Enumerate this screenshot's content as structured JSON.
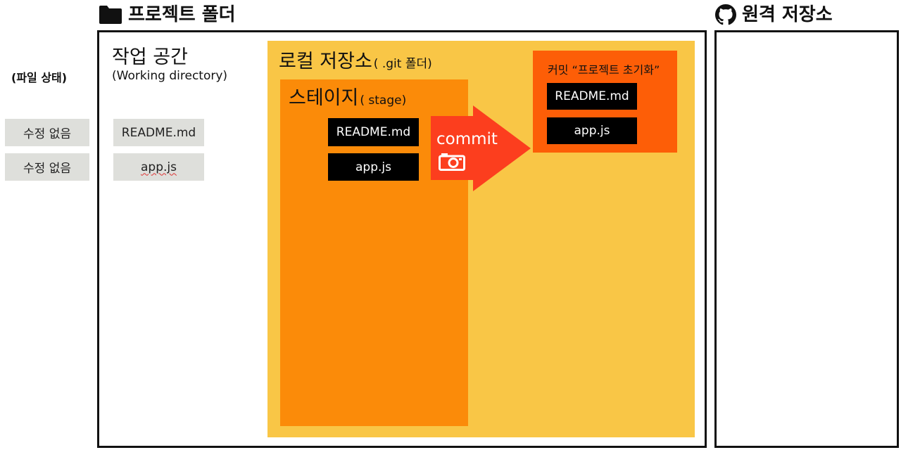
{
  "project_folder": {
    "title": "프로젝트 폴더",
    "icon": "folder-icon"
  },
  "remote_repo": {
    "title": "원격 저장소",
    "icon": "github-icon"
  },
  "file_status": {
    "heading": "(파일 상태)",
    "items": [
      "수정 없음",
      "수정 없음"
    ]
  },
  "working_directory": {
    "title": "작업 공간",
    "subtitle": "(Working directory)",
    "files": [
      "README.md",
      "app.js"
    ]
  },
  "local_repo": {
    "title": "로컬 저장소",
    "suffix": "( .git 폴더)"
  },
  "stage": {
    "title": "스테이지",
    "suffix": "( stage)",
    "files": [
      "README.md",
      "app.js"
    ]
  },
  "commit_arrow": {
    "label": "commit",
    "icon": "camera-icon",
    "color": "#fc3e1e"
  },
  "commit": {
    "title": "커밋 “프로젝트 초기화”",
    "files": [
      "README.md",
      "app.js"
    ]
  },
  "colors": {
    "local_repo": "#f9c646",
    "stage": "#fb8b09",
    "commit_box": "#fd5e07",
    "file_chip": "#000000",
    "status_chip": "#dedfdb"
  }
}
